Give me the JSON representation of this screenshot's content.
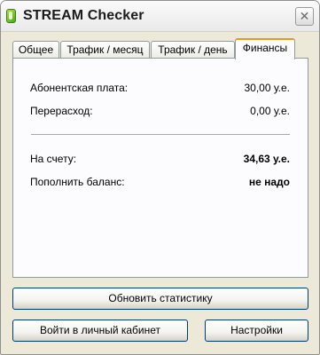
{
  "window": {
    "title": "STREAM Checker",
    "close_symbol": "✕"
  },
  "tabs": [
    {
      "label": "Общее"
    },
    {
      "label": "Трафик / месяц"
    },
    {
      "label": "Трафик / день"
    },
    {
      "label": "Финансы",
      "active": true
    }
  ],
  "finances": {
    "subscription_label": "Абонентская плата:",
    "subscription_value": "30,00 у.е.",
    "overspend_label": "Перерасход:",
    "overspend_value": "0,00 у.е.",
    "balance_label": "На счету:",
    "balance_value": "34,63 у.е.",
    "topup_label": "Пополнить баланс:",
    "topup_value": "не надо"
  },
  "buttons": {
    "refresh_label": "Обновить статистику",
    "cabinet_label": "Войти в личный кабинет",
    "settings_label": "Настройки"
  },
  "icons": {
    "app": "app-icon",
    "close": "close-icon"
  }
}
